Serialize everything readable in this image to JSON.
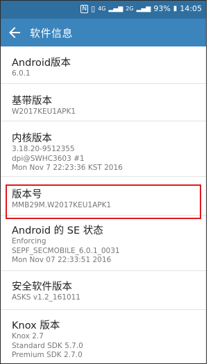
{
  "status_bar": {
    "nfc": "N",
    "net1": "4G",
    "net2": "2G",
    "battery": "93%",
    "time": "14:05"
  },
  "app_bar": {
    "title": "软件信息"
  },
  "items": [
    {
      "title": "Android版本",
      "lines": [
        "6.0.1"
      ]
    },
    {
      "title": "基带版本",
      "lines": [
        "W2017KEU1APK1"
      ]
    },
    {
      "title": "内核版本",
      "lines": [
        "3.18.20-9512355",
        "dpi@SWHC3603 #1",
        "Mon Nov 7 22:23:36 KST 2016"
      ]
    },
    {
      "title": "版本号",
      "lines": [
        "MMB29M.W2017KEU1APK1"
      ]
    },
    {
      "title": "Android 的 SE 状态",
      "lines": [
        "Enforcing",
        "SEPF_SECMOBILE_6.0.1_0031",
        "Mon Nov 07 22:33:51 2016"
      ]
    },
    {
      "title": "安全软件版本",
      "lines": [
        "ASKS v1.2_161011"
      ]
    },
    {
      "title": "Knox 版本",
      "lines": [
        "Knox 2.7",
        "Standard SDK 5.7.0",
        "Premium SDK 2.7.0"
      ]
    }
  ]
}
